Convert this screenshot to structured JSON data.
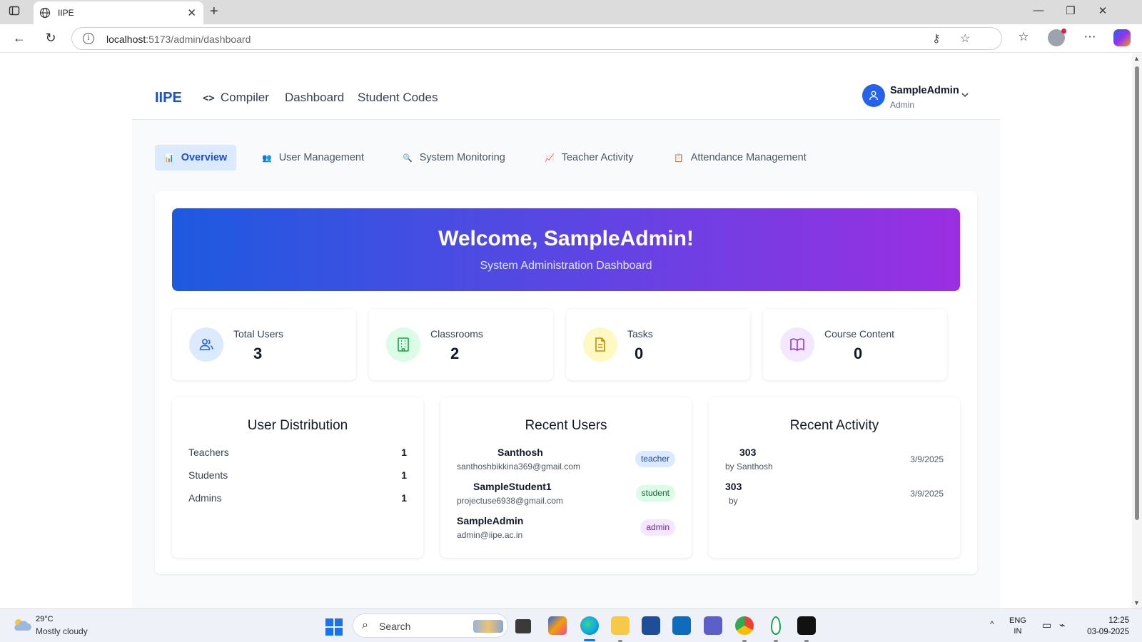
{
  "browser": {
    "tab_title": "IIPE",
    "url_host": "localhost",
    "url_rest": ":5173/admin/dashboard"
  },
  "header": {
    "brand": "IIPE",
    "nav": [
      {
        "label": "Compiler"
      },
      {
        "label": "Dashboard"
      },
      {
        "label": "Student Codes"
      }
    ],
    "user": {
      "name": "SampleAdmin",
      "role": "Admin"
    }
  },
  "tabs": [
    {
      "label": "Overview",
      "icon": "chart-icon",
      "active": true
    },
    {
      "label": "User Management",
      "icon": "users-icon",
      "active": false
    },
    {
      "label": "System Monitoring",
      "icon": "magnifier-icon",
      "active": false
    },
    {
      "label": "Teacher Activity",
      "icon": "trend-chart-icon",
      "active": false
    },
    {
      "label": "Attendance Management",
      "icon": "clipboard-icon",
      "active": false
    }
  ],
  "hero": {
    "title": "Welcome, SampleAdmin!",
    "subtitle": "System Administration Dashboard"
  },
  "stats": [
    {
      "label": "Total Users",
      "value": "3",
      "icon": "users-icon",
      "color": "#2563eb",
      "bg": "#dbeafe"
    },
    {
      "label": "Classrooms",
      "value": "2",
      "icon": "building-icon",
      "color": "#16a34a",
      "bg": "#dcfce7"
    },
    {
      "label": "Tasks",
      "value": "0",
      "icon": "document-icon",
      "color": "#ca8a04",
      "bg": "#fef9c3"
    },
    {
      "label": "Course Content",
      "value": "0",
      "icon": "book-icon",
      "color": "#9333ea",
      "bg": "#f3e8ff"
    }
  ],
  "user_distribution": {
    "title": "User Distribution",
    "rows": [
      {
        "label": "Teachers",
        "count": "1"
      },
      {
        "label": "Students",
        "count": "1"
      },
      {
        "label": "Admins",
        "count": "1"
      }
    ]
  },
  "recent_users": {
    "title": "Recent Users",
    "items": [
      {
        "name": "Santhosh",
        "email": "santhoshbikkina369@gmail.com",
        "role": "teacher",
        "badge_bg": "#dbeafe",
        "badge_fg": "#1e40af"
      },
      {
        "name": "SampleStudent1",
        "email": "projectuse6938@gmail.com",
        "role": "student",
        "badge_bg": "#dcfce7",
        "badge_fg": "#166534"
      },
      {
        "name": "SampleAdmin",
        "email": "admin@iipe.ac.in",
        "role": "admin",
        "badge_bg": "#f3e8ff",
        "badge_fg": "#6b21a8"
      }
    ]
  },
  "recent_activity": {
    "title": "Recent Activity",
    "items": [
      {
        "title": "303",
        "by": "by Santhosh",
        "date": "3/9/2025"
      },
      {
        "title": "303",
        "by": "by",
        "date": "3/9/2025"
      }
    ]
  },
  "taskbar": {
    "weather_temp": "29°C",
    "weather_desc": "Mostly cloudy",
    "search_placeholder": "Search",
    "lang_top": "ENG",
    "lang_bottom": "IN",
    "time": "12:25",
    "date": "03-09-2025"
  },
  "colors": {
    "brand": "#1d4ed8",
    "hero_start": "#1d5ae0",
    "hero_end": "#9b2fe2"
  }
}
